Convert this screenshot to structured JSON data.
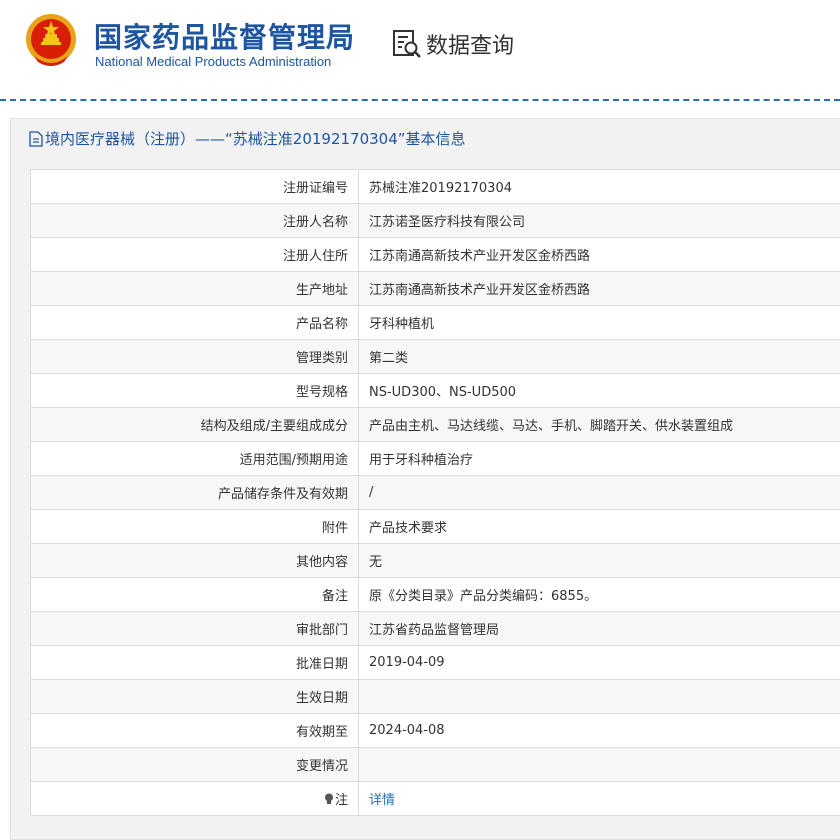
{
  "header": {
    "title_cn": "国家药品监督管理局",
    "title_en": "National Medical Products Administration",
    "query_label": "数据查询"
  },
  "panel": {
    "title": "境内医疗器械（注册）——“苏械注准20192170304”基本信息"
  },
  "rows": [
    {
      "label": "注册证编号",
      "value": "苏械注准20192170304"
    },
    {
      "label": "注册人名称",
      "value": "江苏诺圣医疗科技有限公司"
    },
    {
      "label": "注册人住所",
      "value": "江苏南通高新技术产业开发区金桥西路"
    },
    {
      "label": "生产地址",
      "value": "江苏南通高新技术产业开发区金桥西路"
    },
    {
      "label": "产品名称",
      "value": "牙科种植机"
    },
    {
      "label": "管理类别",
      "value": "第二类"
    },
    {
      "label": "型号规格",
      "value": "NS-UD300、NS-UD500"
    },
    {
      "label": "结构及组成/主要组成成分",
      "value": "产品由主机、马达线缆、马达、手机、脚踏开关、供水装置组成"
    },
    {
      "label": "适用范围/预期用途",
      "value": "用于牙科种植治疗"
    },
    {
      "label": "产品储存条件及有效期",
      "value": "/"
    },
    {
      "label": "附件",
      "value": "产品技术要求"
    },
    {
      "label": "其他内容",
      "value": "无"
    },
    {
      "label": "备注",
      "value": "原《分类目录》产品分类编码：6855。"
    },
    {
      "label": "审批部门",
      "value": "江苏省药品监督管理局"
    },
    {
      "label": "批准日期",
      "value": "2019-04-09"
    },
    {
      "label": "生效日期",
      "value": ""
    },
    {
      "label": "有效期至",
      "value": "2024-04-08"
    },
    {
      "label": "变更情况",
      "value": ""
    }
  ],
  "note_row": {
    "label": "注",
    "value": "详情"
  },
  "icons": {
    "emblem": "national-emblem-icon",
    "query": "data-query-icon",
    "doc": "document-icon",
    "bulb": "lightbulb-icon"
  }
}
